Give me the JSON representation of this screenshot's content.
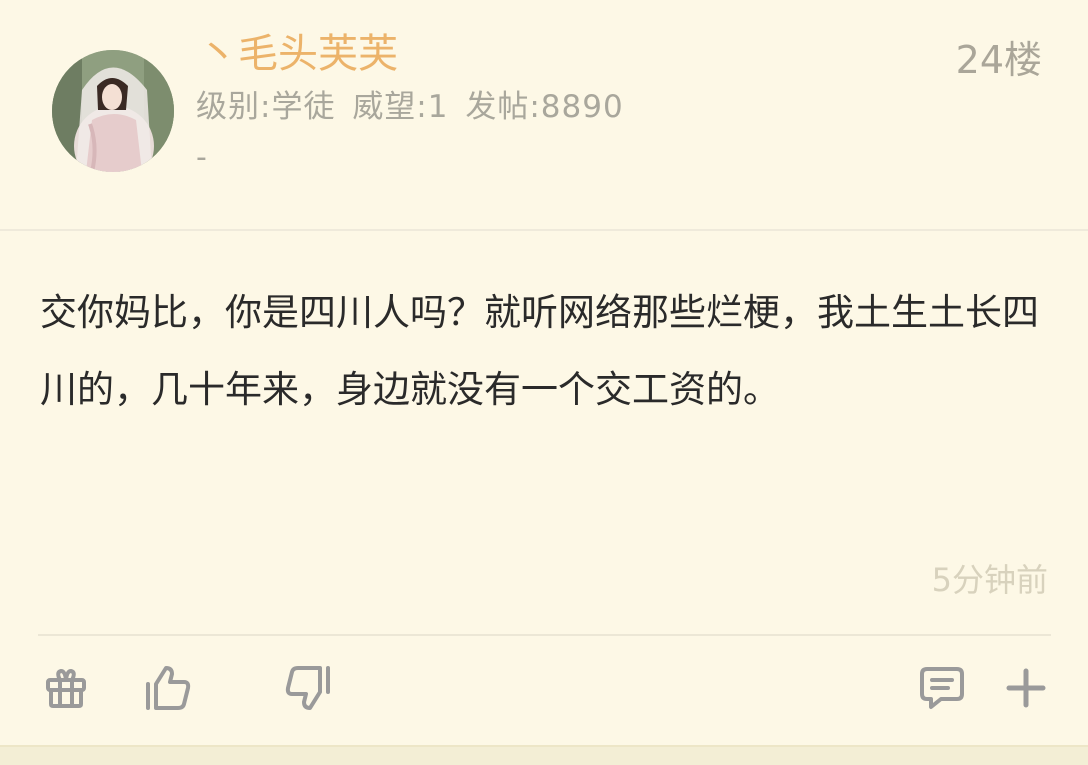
{
  "post": {
    "username": "丶毛头芙芙",
    "username_color": "#ecb36a",
    "meta": {
      "level": "级别:学徒",
      "prestige": "威望:1",
      "posts": "发帖:8890"
    },
    "signature": "-",
    "floor": "24楼",
    "content": "交你妈比，你是四川人吗？就听网络那些烂梗，我土生土长四川的，几十年来，身边就没有一个交工资的。",
    "time": "5分钟前"
  },
  "actions": {
    "gift": "gift-icon",
    "like": "thumbs-up-icon",
    "dislike": "thumbs-down-icon",
    "comment": "comment-icon",
    "more": "plus-icon"
  },
  "colors": {
    "background": "#fdf8e6",
    "icon": "#9a9a9a"
  }
}
